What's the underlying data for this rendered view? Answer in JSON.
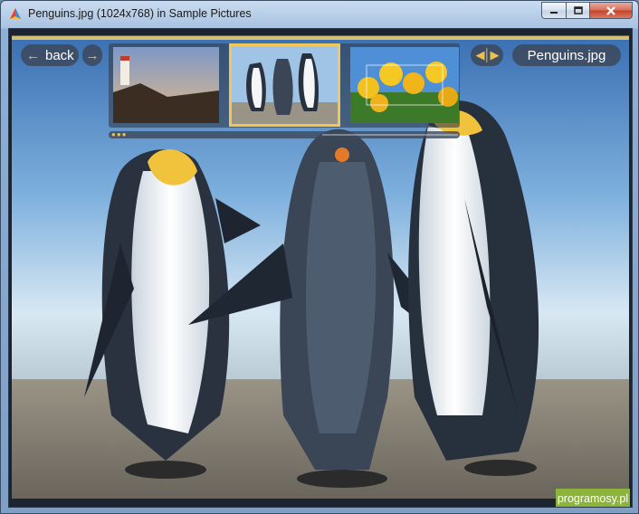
{
  "window": {
    "title": "Penguins.jpg (1024x768) in Sample Pictures",
    "controls": {
      "minimize": "minimize",
      "maximize": "maximize",
      "close": "close"
    }
  },
  "toolbar": {
    "back_label": "back",
    "back_icon": "arrow-left-icon",
    "forward_icon": "arrow-right-icon",
    "nav_icon": "prev-next-icon",
    "filename": "Penguins.jpg"
  },
  "thumbnails": [
    {
      "name": "Lighthouse",
      "selected": false
    },
    {
      "name": "Penguins",
      "selected": true
    },
    {
      "name": "Tulips",
      "selected": false
    }
  ],
  "watermark": "programosy.pl",
  "colors": {
    "accent": "#f0c14a",
    "frame": "#8fb0d6",
    "watermark_bg": "#8cb43a"
  }
}
